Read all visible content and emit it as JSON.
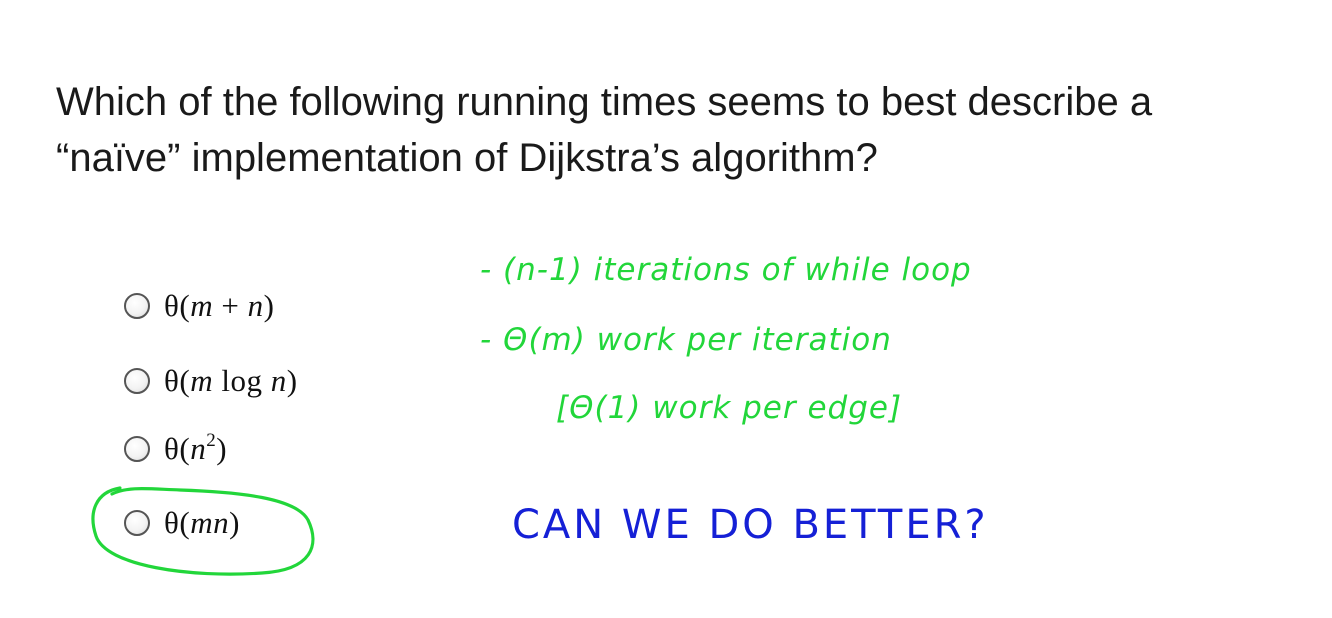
{
  "question": {
    "line1": "Which of the following running times seems to best describe a",
    "line2": "“naïve” implementation of Dijkstra’s algorithm?"
  },
  "options": [
    {
      "label": "θ(m + n)",
      "selected": false
    },
    {
      "label": "θ(m log n)",
      "selected": false
    },
    {
      "label": "θ(n²)",
      "selected": false
    },
    {
      "label": "θ(mn)",
      "selected": false,
      "circled": true
    }
  ],
  "annotations": {
    "note1": "- (n-1) iterations of while loop",
    "note2": "- Θ(m) work per iteration",
    "note3": "[Θ(1) work per edge]",
    "note4": "CAN WE DO BETTER?"
  },
  "colors": {
    "green_ink": "#22d63a",
    "blue_ink": "#1520d6",
    "text": "#1a1a1a"
  }
}
